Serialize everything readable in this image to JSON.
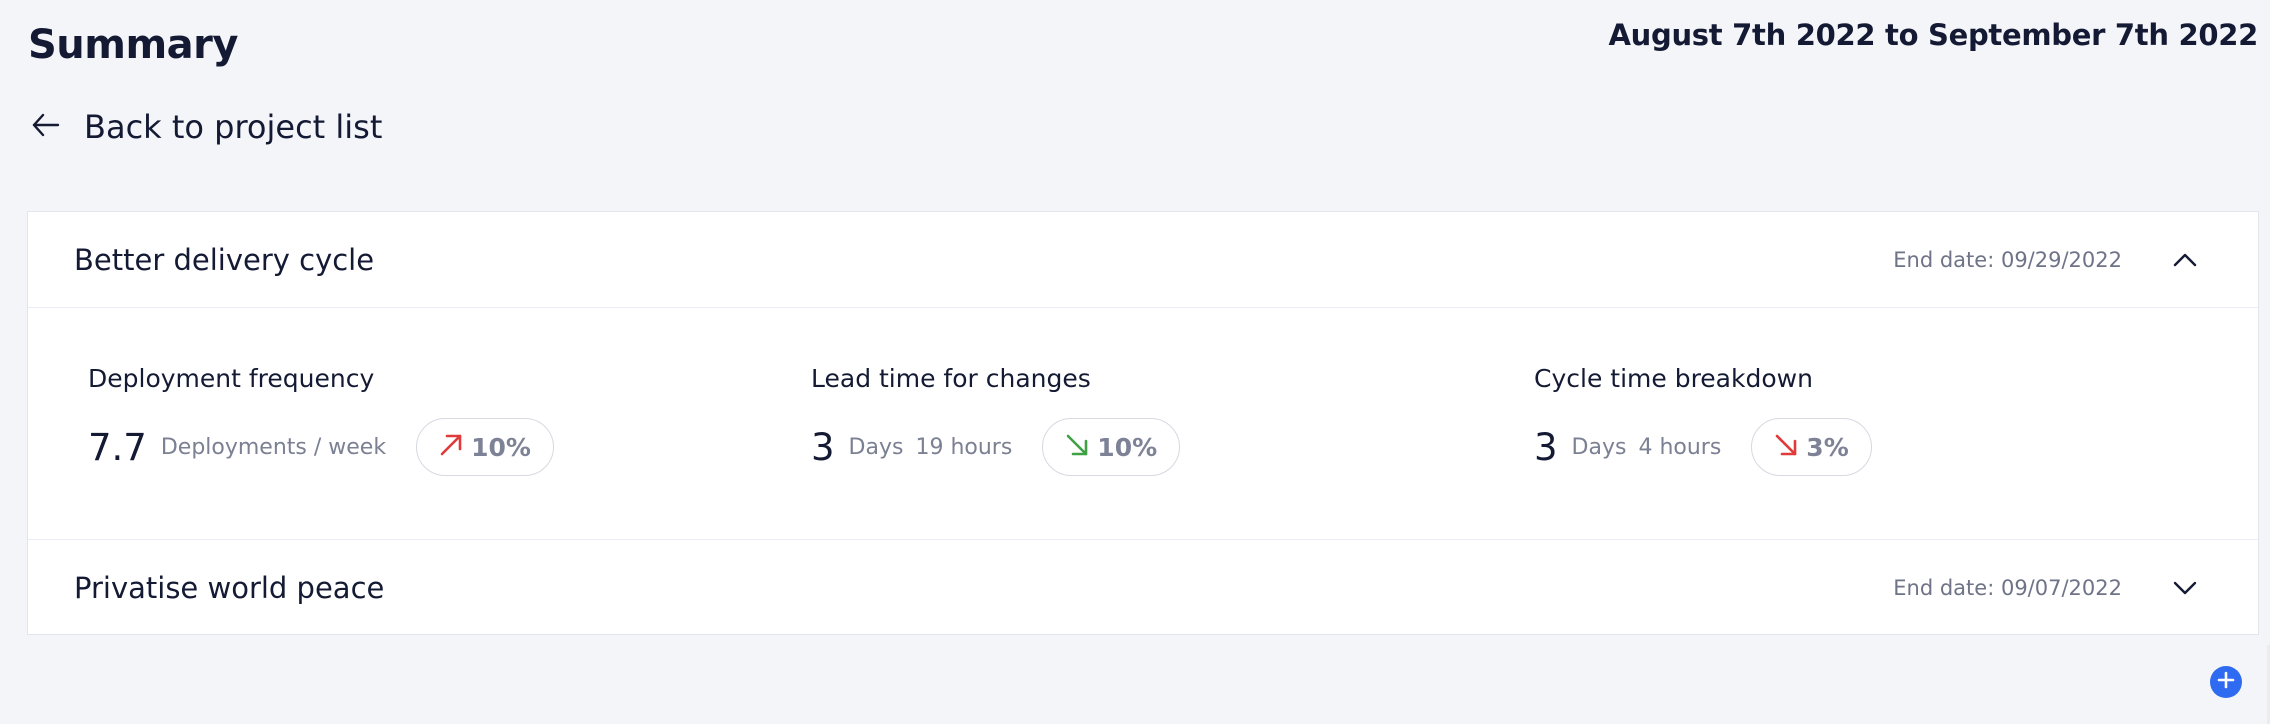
{
  "header": {
    "title": "Summary",
    "date_range": "August 7th 2022 to September 7th 2022"
  },
  "back_link": {
    "label": "Back to project list",
    "icon": "arrow-left-icon"
  },
  "projects": [
    {
      "name": "Better delivery cycle",
      "end_date": "End date: 09/29/2022",
      "expanded": true,
      "chevron_icon": "chevron-up-icon",
      "metrics": [
        {
          "title": "Deployment frequency",
          "value": "7.7",
          "unit": "Deployments / week",
          "unit2": "",
          "trend": {
            "direction": "up",
            "percent": "10%",
            "color": "#e03a3a",
            "icon": "arrow-up-right-icon"
          }
        },
        {
          "title": "Lead time for changes",
          "value": "3",
          "unit": "Days",
          "unit2": "19 hours",
          "trend": {
            "direction": "down",
            "percent": "10%",
            "color": "#3fa044",
            "icon": "arrow-down-right-icon"
          }
        },
        {
          "title": "Cycle time breakdown",
          "value": "3",
          "unit": "Days",
          "unit2": "4 hours",
          "trend": {
            "direction": "down",
            "percent": "3%",
            "color": "#e03a3a",
            "icon": "arrow-down-right-icon"
          }
        }
      ]
    },
    {
      "name": "Privatise world peace",
      "end_date": "End date: 09/07/2022",
      "expanded": false,
      "chevron_icon": "chevron-down-icon"
    }
  ],
  "fab": {
    "icon": "plus-icon",
    "color": "#2f6bf0"
  }
}
